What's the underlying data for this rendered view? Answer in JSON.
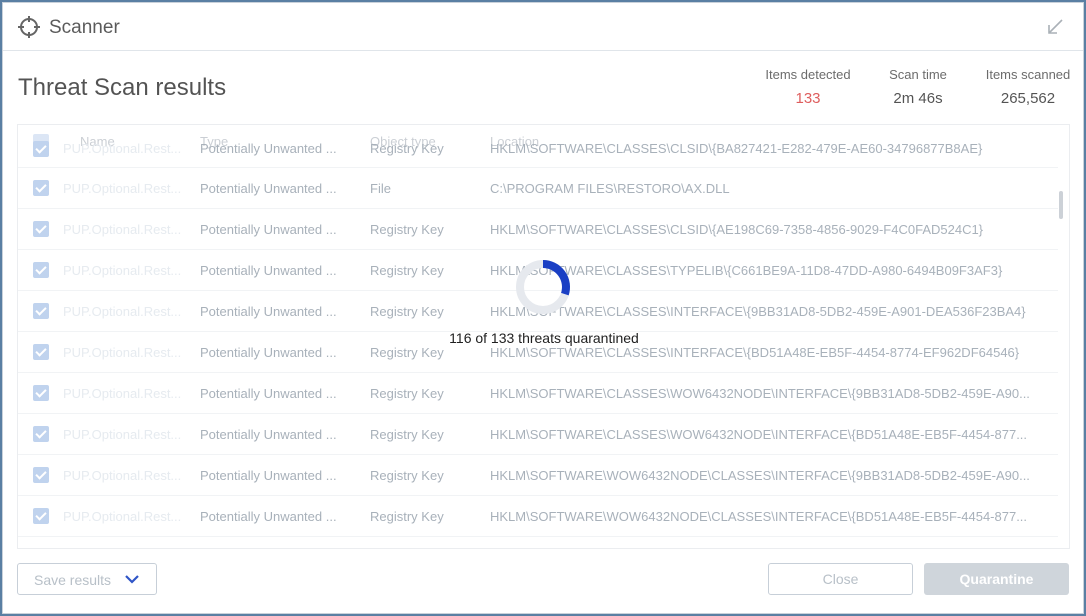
{
  "window": {
    "title": "Scanner",
    "minimize_icon": "collapse-arrow-icon"
  },
  "page": {
    "heading": "Threat Scan results"
  },
  "stats": [
    {
      "label": "Items detected",
      "value": "133",
      "color": "#d11f1f"
    },
    {
      "label": "Scan time",
      "value": "2m 46s"
    },
    {
      "label": "Items scanned",
      "value": "265,562"
    }
  ],
  "table": {
    "columns": [
      "Name",
      "Type",
      "Object type",
      "Location"
    ],
    "rows": [
      {
        "name": "PUP.Optional.Rest...",
        "type": "Potentially Unwanted ...",
        "object_type": "Registry Key",
        "location": "HKLM\\SOFTWARE\\CLASSES\\CLSID\\{BA827421-E282-479E-AE60-34796877B8AE}"
      },
      {
        "name": "PUP.Optional.Rest...",
        "type": "Potentially Unwanted ...",
        "object_type": "File",
        "location": "C:\\PROGRAM FILES\\RESTORO\\AX.DLL"
      },
      {
        "name": "PUP.Optional.Rest...",
        "type": "Potentially Unwanted ...",
        "object_type": "Registry Key",
        "location": "HKLM\\SOFTWARE\\CLASSES\\CLSID\\{AE198C69-7358-4856-9029-F4C0FAD524C1}"
      },
      {
        "name": "PUP.Optional.Rest...",
        "type": "Potentially Unwanted ...",
        "object_type": "Registry Key",
        "location": "HKLM\\SOFTWARE\\CLASSES\\TYPELIB\\{C661BE9A-11D8-47DD-A980-6494B09F3AF3}"
      },
      {
        "name": "PUP.Optional.Rest...",
        "type": "Potentially Unwanted ...",
        "object_type": "Registry Key",
        "location": "HKLM\\SOFTWARE\\CLASSES\\INTERFACE\\{9BB31AD8-5DB2-459E-A901-DEA536F23BA4}"
      },
      {
        "name": "PUP.Optional.Rest...",
        "type": "Potentially Unwanted ...",
        "object_type": "Registry Key",
        "location": "HKLM\\SOFTWARE\\CLASSES\\INTERFACE\\{BD51A48E-EB5F-4454-8774-EF962DF64546}"
      },
      {
        "name": "PUP.Optional.Rest...",
        "type": "Potentially Unwanted ...",
        "object_type": "Registry Key",
        "location": "HKLM\\SOFTWARE\\CLASSES\\WOW6432NODE\\INTERFACE\\{9BB31AD8-5DB2-459E-A90..."
      },
      {
        "name": "PUP.Optional.Rest...",
        "type": "Potentially Unwanted ...",
        "object_type": "Registry Key",
        "location": "HKLM\\SOFTWARE\\CLASSES\\WOW6432NODE\\INTERFACE\\{BD51A48E-EB5F-4454-877..."
      },
      {
        "name": "PUP.Optional.Rest...",
        "type": "Potentially Unwanted ...",
        "object_type": "Registry Key",
        "location": "HKLM\\SOFTWARE\\WOW6432NODE\\CLASSES\\INTERFACE\\{9BB31AD8-5DB2-459E-A90..."
      },
      {
        "name": "PUP.Optional.Rest...",
        "type": "Potentially Unwanted ...",
        "object_type": "Registry Key",
        "location": "HKLM\\SOFTWARE\\WOW6432NODE\\CLASSES\\INTERFACE\\{BD51A48E-EB5F-4454-877..."
      }
    ]
  },
  "progress": {
    "text": "116 of 133 threats quarantined",
    "done": 116,
    "total": 133,
    "color": "#1a3fc4"
  },
  "buttons": {
    "save": "Save results",
    "close": "Close",
    "quarantine": "Quarantine"
  }
}
